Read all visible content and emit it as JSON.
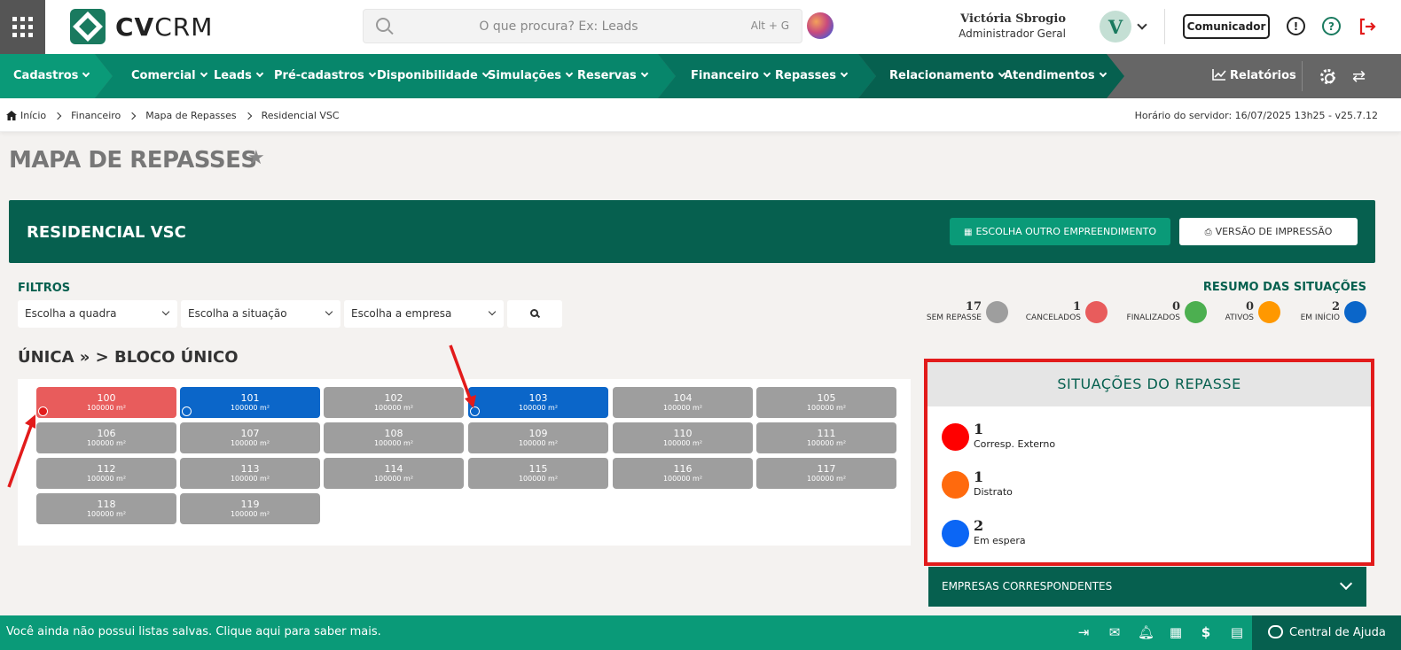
{
  "topbar": {
    "logo_prefix": "CV",
    "logo_suffix": "CRM",
    "search_placeholder": "O que procura? Ex: Leads",
    "search_shortcut": "Alt + G",
    "user_name": "Victória Sbrogio",
    "user_role": "Administrador Geral",
    "avatar_initial": "V",
    "comunicador_label": "Comunicador",
    "info_glyph": "!",
    "help_glyph": "?"
  },
  "nav": {
    "items": [
      {
        "label": "Cadastros"
      },
      {
        "label": "Comercial"
      },
      {
        "label": "Leads"
      },
      {
        "label": "Pré-cadastros"
      },
      {
        "label": "Disponibilidade"
      },
      {
        "label": "Simulações"
      },
      {
        "label": "Reservas"
      },
      {
        "label": "Financeiro"
      },
      {
        "label": "Repasses"
      },
      {
        "label": "Relacionamento"
      },
      {
        "label": "Atendimentos"
      }
    ],
    "reports_label": "Relatórios",
    "colors": {
      "green_light": "#0a9a78",
      "green_mid": "#06806a",
      "green_dark": "#06604f",
      "gray": "#666666"
    }
  },
  "breadcrumb": {
    "items": [
      "Início",
      "Financeiro",
      "Mapa de Repasses",
      "Residencial VSC"
    ],
    "server_time": "Horário do servidor: 16/07/2025 13h25 - v25.7.12"
  },
  "page": {
    "title": "MAPA DE REPASSES",
    "venture_name": "RESIDENCIAL VSC",
    "choose_button": "ESCOLHA OUTRO EMPREENDIMENTO",
    "print_button": "VERSÃO DE IMPRESSÃO"
  },
  "filters": {
    "label": "FILTROS",
    "quadra": "Escolha a quadra",
    "situacao": "Escolha a situação",
    "empresa": "Escolha a empresa"
  },
  "summary": {
    "label": "RESUMO DAS SITUAÇÕES",
    "items": [
      {
        "count": "17",
        "label": "SEM REPASSE",
        "color": "#9e9e9e"
      },
      {
        "count": "1",
        "label": "CANCELADOS",
        "color": "#e85c5c"
      },
      {
        "count": "0",
        "label": "FINALIZADOS",
        "color": "#4caf50"
      },
      {
        "count": "0",
        "label": "ATIVOS",
        "color": "#ff9800"
      },
      {
        "count": "2",
        "label": "EM INÍCIO",
        "color": "#0b66c9"
      }
    ]
  },
  "block": {
    "title": "ÚNICA » > BLOCO ÚNICO",
    "units": [
      {
        "num": "100",
        "area": "100000 m²",
        "status": "cancelado",
        "marker": "#e21b1b"
      },
      {
        "num": "101",
        "area": "100000 m²",
        "status": "inicio",
        "marker": "#0b66c9"
      },
      {
        "num": "102",
        "area": "100000 m²",
        "status": "sem"
      },
      {
        "num": "103",
        "area": "100000 m²",
        "status": "inicio",
        "marker": "#0b66c9"
      },
      {
        "num": "104",
        "area": "100000 m²",
        "status": "sem"
      },
      {
        "num": "105",
        "area": "100000 m²",
        "status": "sem"
      },
      {
        "num": "106",
        "area": "100000 m²",
        "status": "sem"
      },
      {
        "num": "107",
        "area": "100000 m²",
        "status": "sem"
      },
      {
        "num": "108",
        "area": "100000 m²",
        "status": "sem"
      },
      {
        "num": "109",
        "area": "100000 m²",
        "status": "sem"
      },
      {
        "num": "110",
        "area": "100000 m²",
        "status": "sem"
      },
      {
        "num": "111",
        "area": "100000 m²",
        "status": "sem"
      },
      {
        "num": "112",
        "area": "100000 m²",
        "status": "sem"
      },
      {
        "num": "113",
        "area": "100000 m²",
        "status": "sem"
      },
      {
        "num": "114",
        "area": "100000 m²",
        "status": "sem"
      },
      {
        "num": "115",
        "area": "100000 m²",
        "status": "sem"
      },
      {
        "num": "116",
        "area": "100000 m²",
        "status": "sem"
      },
      {
        "num": "117",
        "area": "100000 m²",
        "status": "sem"
      },
      {
        "num": "118",
        "area": "100000 m²",
        "status": "sem"
      },
      {
        "num": "119",
        "area": "100000 m²",
        "status": "sem"
      }
    ],
    "status_colors": {
      "cancelado": "#e85c5c",
      "inicio": "#0b66c9",
      "sem": "#9e9e9e"
    }
  },
  "situations": {
    "title": "SITUAÇÕES DO REPASSE",
    "items": [
      {
        "count": "1",
        "label": "Corresp. Externo",
        "color": "#ff0000"
      },
      {
        "count": "1",
        "label": "Distrato",
        "color": "#ff6a0d"
      },
      {
        "count": "2",
        "label": "Em espera",
        "color": "#0b66f5"
      }
    ]
  },
  "empresas_label": "EMPRESAS CORRESPONDENTES",
  "footer": {
    "message": "Você ainda não possui listas salvas. Clique aqui para saber mais.",
    "help_center": "Central de Ajuda"
  },
  "highlight_color": "#e21b1b"
}
